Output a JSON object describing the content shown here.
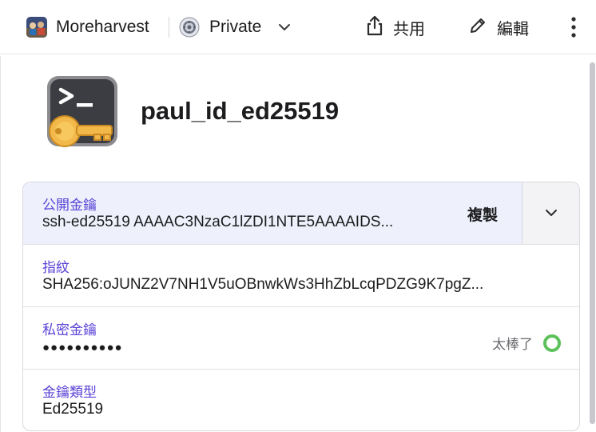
{
  "topbar": {
    "vault_name": "Moreharvest",
    "vault_avatar_icon": "vault-avatar-icon",
    "visibility_label": "Private",
    "visibility_icon": "private-vault-icon",
    "share_label": "共用",
    "edit_label": "編輯"
  },
  "item": {
    "title": "paul_id_ed25519",
    "icon": "ssh-key-icon"
  },
  "fields": {
    "public_key": {
      "label": "公開金鑰",
      "value": "ssh-ed25519 AAAAC3NzaC1lZDI1NTE5AAAAIDS...",
      "copy_label": "複製"
    },
    "fingerprint": {
      "label": "指紋",
      "value": "SHA256:oJUNZ2V7NH1V5uOBnwkWs3HhZbLcqPDZG9K7pgZ..."
    },
    "private_key": {
      "label": "私密金鑰",
      "value": "●●●●●●●●●●",
      "strength_label": "太棒了"
    },
    "key_type": {
      "label": "金鑰類型",
      "value": "Ed25519"
    }
  },
  "colors": {
    "field_label": "#5a43d6",
    "highlight_row": "#eef1fb",
    "strength_ok": "#5cc15a"
  }
}
